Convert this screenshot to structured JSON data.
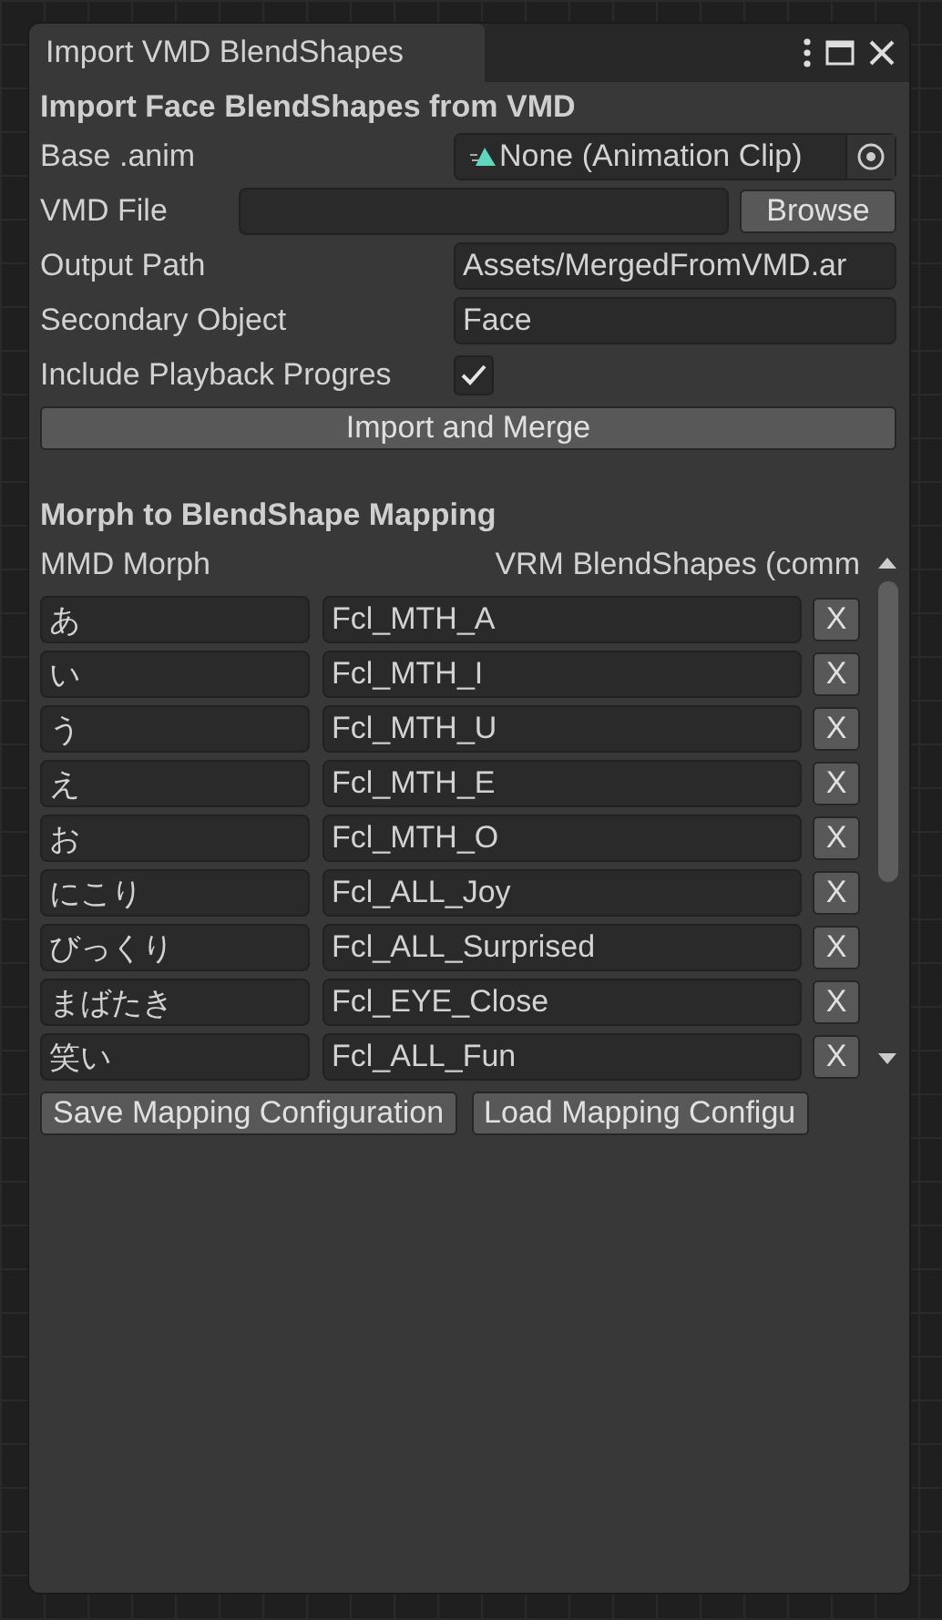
{
  "window": {
    "title": "Import VMD BlendShapes"
  },
  "heading": "Import Face BlendShapes from VMD",
  "fields": [
    {
      "kind": "object",
      "label": "Base .anim",
      "value": "None (Animation Clip)"
    },
    {
      "kind": "file",
      "label": "VMD File",
      "button": "Browse"
    },
    {
      "kind": "text",
      "label": "Output Path",
      "value": "Assets/MergedFromVMD.ar"
    },
    {
      "kind": "text",
      "label": "Secondary Object",
      "value": "Face"
    },
    {
      "kind": "checkbox",
      "label": "Include Playback Progres",
      "checked": true
    }
  ],
  "import_button": "Import and Merge",
  "mapping": {
    "title": "Morph to BlendShape Mapping",
    "columns": [
      "MMD Morph",
      "VRM BlendShapes (comm"
    ],
    "rows": [
      {
        "morph": "あ",
        "blendshape": "Fcl_MTH_A",
        "remove": "X"
      },
      {
        "morph": "い",
        "blendshape": "Fcl_MTH_I",
        "remove": "X"
      },
      {
        "morph": "う",
        "blendshape": "Fcl_MTH_U",
        "remove": "X"
      },
      {
        "morph": "え",
        "blendshape": "Fcl_MTH_E",
        "remove": "X"
      },
      {
        "morph": "お",
        "blendshape": "Fcl_MTH_O",
        "remove": "X"
      },
      {
        "morph": "にこり",
        "blendshape": "Fcl_ALL_Joy",
        "remove": "X"
      },
      {
        "morph": "びっくり",
        "blendshape": "Fcl_ALL_Surprised",
        "remove": "X"
      },
      {
        "morph": "まばたき",
        "blendshape": "Fcl_EYE_Close",
        "remove": "X"
      },
      {
        "morph": "笑い",
        "blendshape": "Fcl_ALL_Fun",
        "remove": "X"
      }
    ]
  },
  "buttons": [
    "Save Mapping Configuration",
    "Load Mapping Configu"
  ]
}
